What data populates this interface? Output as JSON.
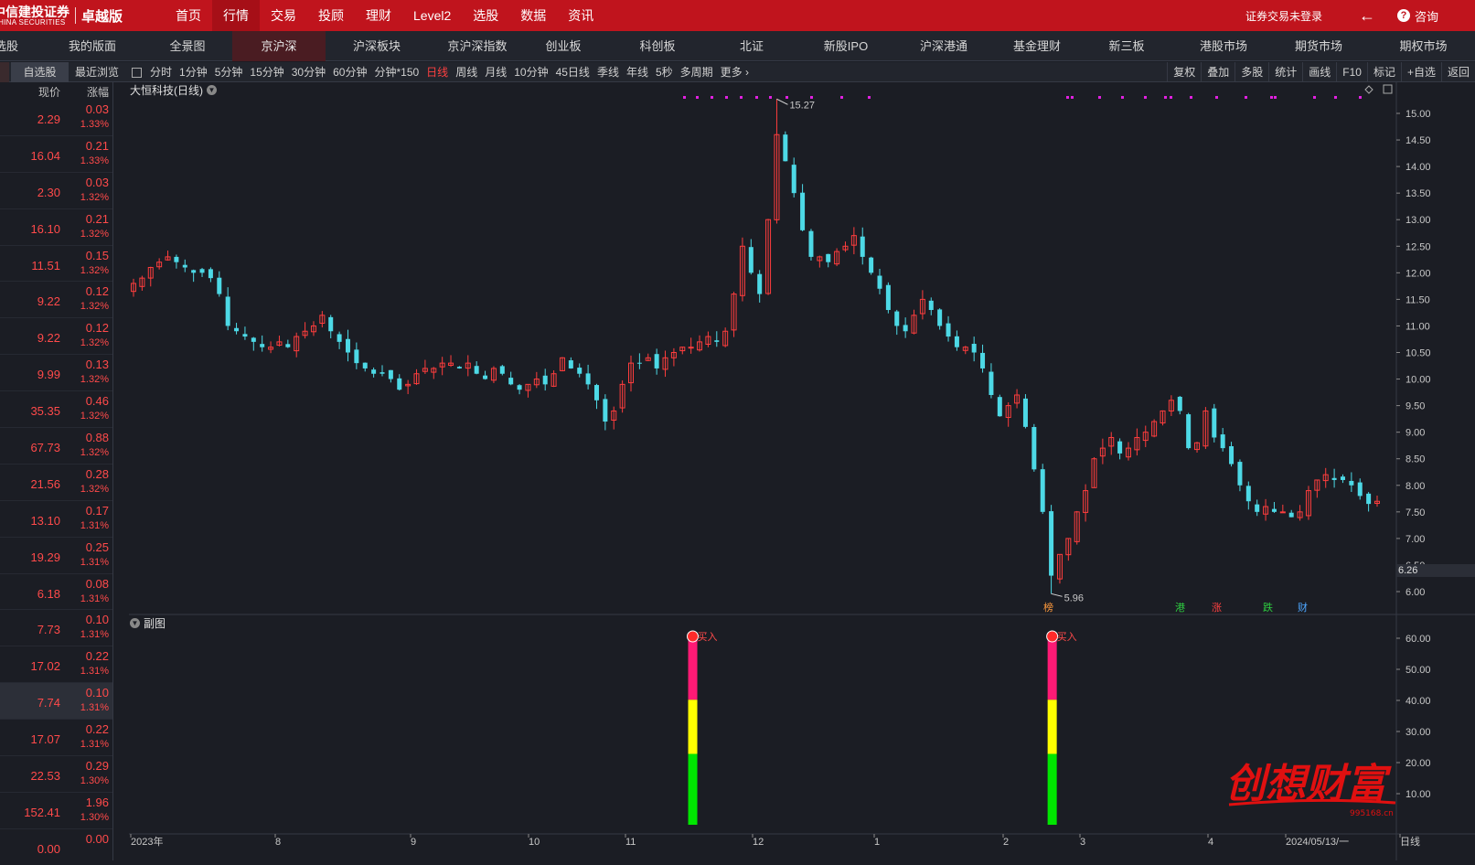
{
  "brand": {
    "name": "中信建投证券",
    "sub": "CHINA SECURITIES",
    "edition": "卓越版"
  },
  "top_nav": [
    "首页",
    "行情",
    "交易",
    "投顾",
    "理财",
    "Level2",
    "选股",
    "数据",
    "资讯"
  ],
  "top_nav_active": 1,
  "top_right": {
    "login_status": "证券交易未登录",
    "consult": "咨询"
  },
  "tabs": [
    {
      "label": "…股",
      "x": 0,
      "w": 20
    },
    {
      "label": "我的版面",
      "x": 62,
      "w": 78
    },
    {
      "label": "全景图",
      "x": 165,
      "w": 80
    },
    {
      "label": "京沪深",
      "x": 262,
      "w": 102
    },
    {
      "label": "沪深板块",
      "x": 374,
      "w": 96
    },
    {
      "label": "京沪深指数",
      "x": 480,
      "w": 96
    },
    {
      "label": "创业板",
      "x": 588,
      "w": 90
    },
    {
      "label": "科创板",
      "x": 690,
      "w": 96
    },
    {
      "label": "北证",
      "x": 798,
      "w": 96
    },
    {
      "label": "新股IPO",
      "x": 904,
      "w": 96
    },
    {
      "label": "沪深港通",
      "x": 1010,
      "w": 96
    },
    {
      "label": "基金理财",
      "x": 1116,
      "w": 96
    },
    {
      "label": "新三板",
      "x": 1220,
      "w": 96
    },
    {
      "label": "港股市场",
      "x": 1326,
      "w": 96
    },
    {
      "label": "期货市场",
      "x": 1432,
      "w": 96
    },
    {
      "label": "期权市场",
      "x": 1536,
      "w": 90
    }
  ],
  "tabs_text": [
    "选股",
    "我的版面",
    "全景图",
    "京沪深",
    "沪深板块",
    "京沪深指数",
    "创业板",
    "科创板",
    "北证",
    "新股IPO",
    "沪深港通",
    "基金理财",
    "新三板",
    "港股市场",
    "期货市场",
    "期权市场"
  ],
  "toolbar": {
    "watch": "自选股",
    "recent": "最近浏览",
    "periods": [
      "分时",
      "1分钟",
      "5分钟",
      "15分钟",
      "30分钟",
      "60分钟",
      "分钟*150",
      "日线",
      "周线",
      "月线",
      "10分钟",
      "45日线",
      "季线",
      "年线",
      "5秒",
      "多周期",
      "更多"
    ],
    "active_period": 7,
    "right_tools": [
      "复权",
      "叠加",
      "多股",
      "统计",
      "画线",
      "F10",
      "标记",
      "+自选",
      "返回"
    ]
  },
  "sidebar": {
    "col_price": "现价",
    "col_change": "涨幅",
    "rows": [
      {
        "price": "2.29",
        "chg": "0.03",
        "pct": "1.33%"
      },
      {
        "price": "16.04",
        "chg": "0.21",
        "pct": "1.33%"
      },
      {
        "price": "2.30",
        "chg": "0.03",
        "pct": "1.32%"
      },
      {
        "price": "16.10",
        "chg": "0.21",
        "pct": "1.32%"
      },
      {
        "price": "11.51",
        "chg": "0.15",
        "pct": "1.32%"
      },
      {
        "price": "9.22",
        "chg": "0.12",
        "pct": "1.32%"
      },
      {
        "price": "9.22",
        "chg": "0.12",
        "pct": "1.32%"
      },
      {
        "price": "9.99",
        "chg": "0.13",
        "pct": "1.32%"
      },
      {
        "price": "35.35",
        "chg": "0.46",
        "pct": "1.32%"
      },
      {
        "price": "67.73",
        "chg": "0.88",
        "pct": "1.32%"
      },
      {
        "price": "21.56",
        "chg": "0.28",
        "pct": "1.32%"
      },
      {
        "price": "13.10",
        "chg": "0.17",
        "pct": "1.31%"
      },
      {
        "price": "19.29",
        "chg": "0.25",
        "pct": "1.31%"
      },
      {
        "price": "6.18",
        "chg": "0.08",
        "pct": "1.31%"
      },
      {
        "price": "7.73",
        "chg": "0.10",
        "pct": "1.31%"
      },
      {
        "price": "17.02",
        "chg": "0.22",
        "pct": "1.31%"
      },
      {
        "price": "7.74",
        "chg": "0.10",
        "pct": "1.31%"
      },
      {
        "price": "17.07",
        "chg": "0.22",
        "pct": "1.31%"
      },
      {
        "price": "22.53",
        "chg": "0.29",
        "pct": "1.30%"
      },
      {
        "price": "152.41",
        "chg": "1.96",
        "pct": "1.30%"
      },
      {
        "price": "0.00",
        "chg": "0.00",
        "pct": ""
      }
    ],
    "selected_index": 16
  },
  "chart": {
    "title": "大恒科技(日线)",
    "sub_title": "副图",
    "current_price_tag": "6.26",
    "high_label": "15.27",
    "low_label": "5.96",
    "y_ticks": [
      "15.00",
      "14.50",
      "14.00",
      "13.50",
      "13.00",
      "12.50",
      "12.00",
      "11.50",
      "11.00",
      "10.50",
      "10.00",
      "9.50",
      "9.00",
      "8.50",
      "8.00",
      "7.50",
      "7.00",
      "6.50",
      "6.00"
    ],
    "sub_y_ticks": [
      "60.00",
      "50.00",
      "40.00",
      "30.00",
      "20.00",
      "10.00"
    ],
    "x_labels": [
      "2023年",
      "8",
      "9",
      "10",
      "11",
      "12",
      "1",
      "2",
      "3",
      "4",
      "2024/05/13/一",
      "日线"
    ],
    "event_tags": [
      {
        "text": "榜",
        "color": "#ff9a3c"
      },
      {
        "text": "港",
        "color": "#2ecc40"
      },
      {
        "text": "涨",
        "color": "#ff4040"
      },
      {
        "text": "跌",
        "color": "#2ecc40"
      },
      {
        "text": "财",
        "color": "#4da6ff"
      }
    ],
    "buy_marker_text": "买入",
    "colors": {
      "up": "#ff3d3d",
      "down": "#4dd9e6",
      "bg": "#1b1d24",
      "grid": "#2a2d36",
      "magenta": "#e020e0",
      "bar_pink": "#ff1a75",
      "bar_yellow": "#ffff00",
      "bar_green": "#00e600"
    }
  },
  "chart_data": {
    "type": "candlestick",
    "title": "大恒科技(日线)",
    "ylim": [
      5.9,
      15.3
    ],
    "high": 15.27,
    "low": 5.96,
    "close_series": [
      11.8,
      11.9,
      12.1,
      12.2,
      12.3,
      12.2,
      12.1,
      12.0,
      12.0,
      11.9,
      11.6,
      11.0,
      10.9,
      10.8,
      10.7,
      10.6,
      10.6,
      10.7,
      10.6,
      10.8,
      10.9,
      11.0,
      11.2,
      10.9,
      10.7,
      10.5,
      10.3,
      10.2,
      10.1,
      10.1,
      10.0,
      9.8,
      9.9,
      10.1,
      10.2,
      10.2,
      10.3,
      10.3,
      10.2,
      10.3,
      10.1,
      10.0,
      10.2,
      10.1,
      9.9,
      9.8,
      9.9,
      10.0,
      9.9,
      10.1,
      10.4,
      10.2,
      10.1,
      9.9,
      9.6,
      9.2,
      9.4,
      9.9,
      10.3,
      10.3,
      10.4,
      10.2,
      10.4,
      10.5,
      10.6,
      10.6,
      10.7,
      10.8,
      10.7,
      10.9,
      11.6,
      12.5,
      12.0,
      11.6,
      13.0,
      14.6,
      14.1,
      13.5,
      12.8,
      12.3,
      12.3,
      12.2,
      12.4,
      12.5,
      12.7,
      12.3,
      12.0,
      11.7,
      11.3,
      11.0,
      10.9,
      11.2,
      11.5,
      11.3,
      11.0,
      10.8,
      10.6,
      10.6,
      10.5,
      10.2,
      9.7,
      9.3,
      9.5,
      9.7,
      9.1,
      8.3,
      7.5,
      6.3,
      6.7,
      7.0,
      7.5,
      7.9,
      8.5,
      8.7,
      8.9,
      8.6,
      8.7,
      8.9,
      9.0,
      9.2,
      9.4,
      9.6,
      9.4,
      8.7,
      8.8,
      9.4,
      8.9,
      8.7,
      8.4,
      8.0,
      7.7,
      7.5,
      7.6,
      7.5,
      7.5,
      7.4,
      7.5,
      7.9,
      8.1,
      8.2,
      8.1,
      8.1,
      8.0,
      7.8,
      7.65,
      7.7
    ],
    "sub_bar_positions": [
      0.448,
      0.736
    ],
    "sub_bar_value": 60
  }
}
